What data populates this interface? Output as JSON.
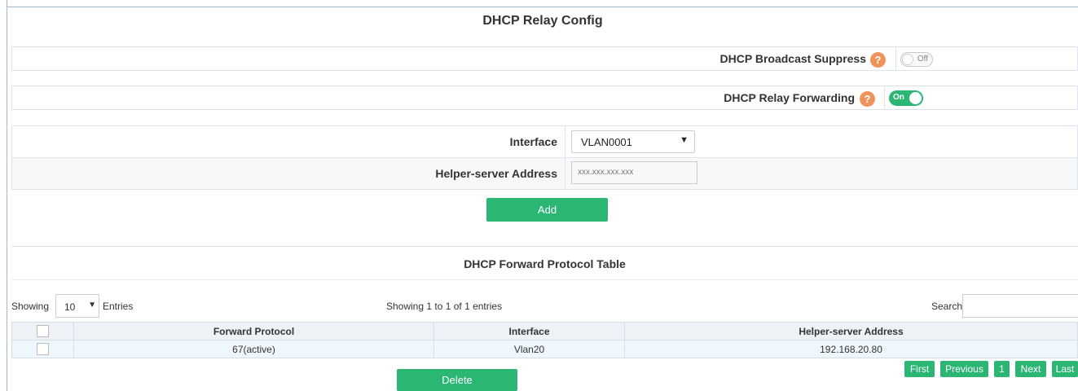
{
  "page": {
    "title": "DHCP Relay Config"
  },
  "broadcast_suppress": {
    "label": "DHCP Broadcast Suppress",
    "help": "?",
    "toggle_text": "Off"
  },
  "relay_forwarding": {
    "label": "DHCP Relay Forwarding",
    "help": "?",
    "toggle_text": "On"
  },
  "form": {
    "interface_label": "Interface",
    "interface_value": "VLAN0001",
    "helper_label": "Helper-server Address",
    "helper_placeholder": "xxx.xxx.xxx.xxx",
    "add_button": "Add"
  },
  "table_section": {
    "title": "DHCP Forward Protocol Table",
    "showing_label": "Showing",
    "page_length": "10",
    "entries_label": "Entries",
    "info": "Showing 1 to 1 of 1 entries",
    "search_label": "Search",
    "columns": [
      "Forward Protocol",
      "Interface",
      "Helper-server Address"
    ],
    "rows": [
      {
        "protocol": "67(active)",
        "interface": "Vlan20",
        "helper": "192.168.20.80"
      }
    ],
    "delete_button": "Delete",
    "pagination": {
      "first": "First",
      "previous": "Previous",
      "page": "1",
      "next": "Next",
      "last": "Last"
    }
  },
  "colors": {
    "accent": "#2bb673",
    "help": "#f0935a"
  },
  "icons": {
    "help": "question-circle-icon",
    "dropdown": "chevron-down-icon"
  }
}
